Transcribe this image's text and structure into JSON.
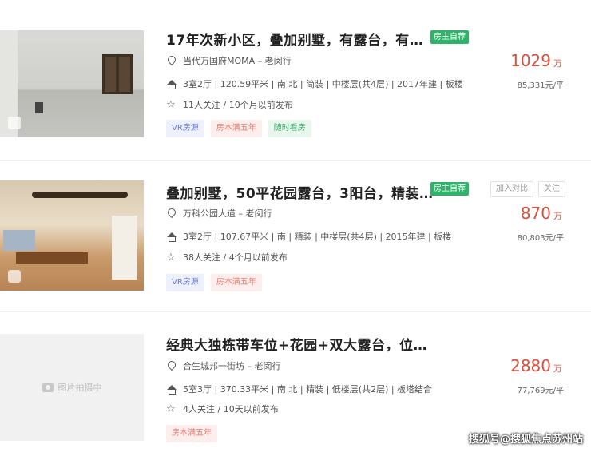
{
  "listings": [
    {
      "title": "17年次新小区，叠加别墅，有露台，有…",
      "owner_badge": "房主自荐",
      "location": "当代万国府MOMA – 老闵行",
      "info": "3室2厅 | 120.59平米 | 南 北 | 简装 | 中楼层(共4层) | 2017年建 | 板楼",
      "follow": "11人关注 / 10个月以前发布",
      "price": "1029",
      "price_unit": "万",
      "unit_price": "85,331元/平",
      "tags": [
        "VR房源",
        "房本满五年",
        "随时看房"
      ]
    },
    {
      "title": "叠加别墅，50平花园露台，3阳台，精装…",
      "owner_badge": "房主自荐",
      "location": "万科公园大道 – 老闵行",
      "info": "3室2厅 | 107.67平米 | 南 | 精装 | 中楼层(共4层) | 2015年建 | 板楼",
      "follow": "38人关注 / 4个月以前发布",
      "price": "870",
      "price_unit": "万",
      "unit_price": "80,803元/平",
      "tags": [
        "VR房源",
        "房本满五年"
      ],
      "compare_label": "加入对比",
      "follow_label": "关注"
    },
    {
      "title": "经典大独栋带车位+花园+双大露台，位…",
      "location": "合生城邦一街坊 – 老闵行",
      "info": "5室3厅 | 370.33平米 | 南 北 | 精装 | 低楼层(共2层) | 板塔结合",
      "follow": "4人关注 / 10天以前发布",
      "price": "2880",
      "price_unit": "万",
      "unit_price": "77,769元/平",
      "tags": [
        "房本满五年"
      ],
      "photo_placeholder": "图片拍摄中"
    }
  ],
  "watermark": "搜狐号@搜狐焦点苏州站",
  "colors": {
    "price": "#d9513c",
    "owner_badge": "#2fb36a",
    "tag_vr": "#6a7bd0",
    "tag_five": "#e07a6a",
    "tag_see": "#3aa868"
  },
  "icons": [
    "location-pin-icon",
    "house-icon",
    "star-icon",
    "camera-icon"
  ]
}
